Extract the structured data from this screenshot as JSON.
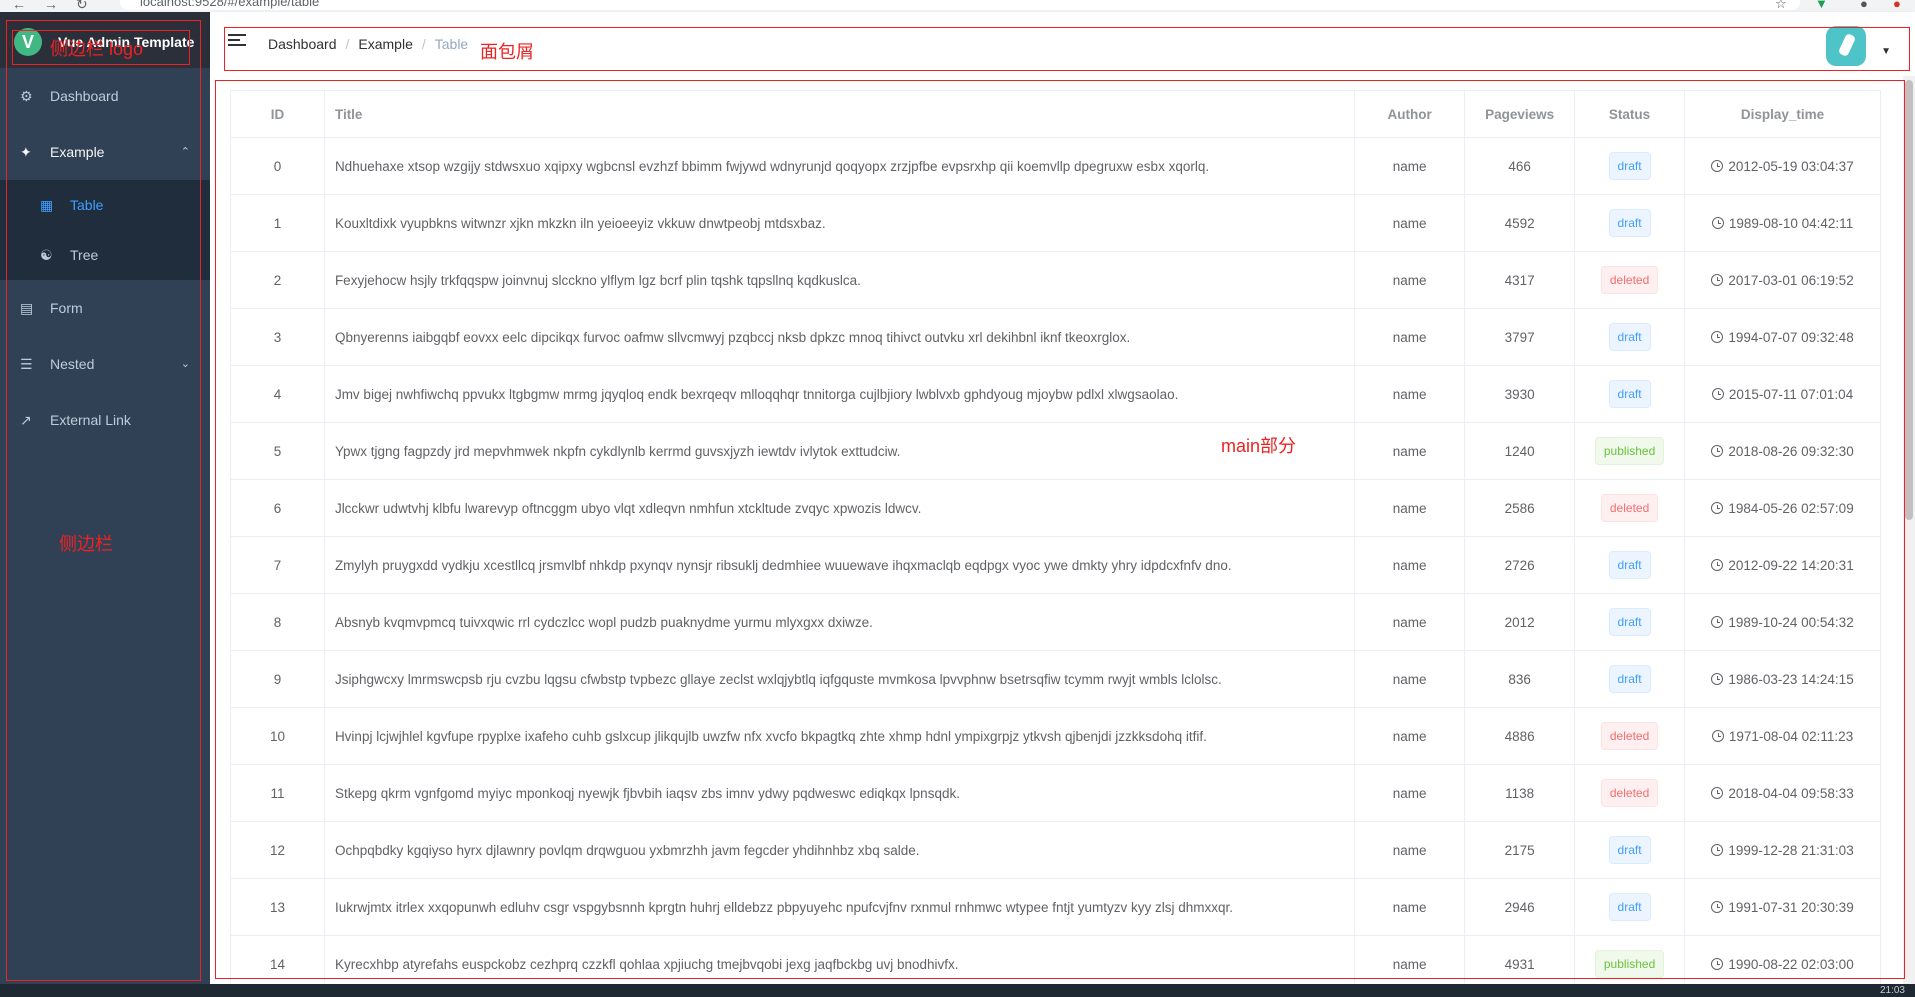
{
  "browser": {
    "url": "localhost:9528/#/example/table"
  },
  "sidebar": {
    "logo_letter": "V",
    "title": "Vue Admin Template",
    "items": [
      {
        "label": "Dashboard",
        "icon": "dashboard-icon"
      },
      {
        "label": "Example",
        "icon": "example-icon",
        "sub": [
          {
            "label": "Table",
            "icon": "table-icon"
          },
          {
            "label": "Tree",
            "icon": "tree-icon"
          }
        ]
      },
      {
        "label": "Form",
        "icon": "form-icon"
      },
      {
        "label": "Nested",
        "icon": "nested-icon"
      },
      {
        "label": "External Link",
        "icon": "link-icon"
      }
    ]
  },
  "annotations": {
    "logo": "侧边栏 logo",
    "breadcrumb": "面包屑",
    "main": "main部分",
    "sidebar": "侧边栏"
  },
  "breadcrumb": [
    "Dashboard",
    "Example",
    "Table"
  ],
  "table": {
    "headers": [
      "ID",
      "Title",
      "Author",
      "Pageviews",
      "Status",
      "Display_time"
    ],
    "rows": [
      [
        "0",
        "Ndhuehaxe xtsop wzgijy stdwsxuo xqipxy wgbcnsl evzhzf bbimm fwjywd wdnyrunjd qoqyopx zrzjpfbe evpsrxhp qii koemvllp dpegruxw esbx xqorlq.",
        "name",
        "466",
        "draft",
        "2012-05-19 03:04:37"
      ],
      [
        "1",
        "Kouxltdixk vyupbkns witwnzr xjkn mkzkn iln yeioeeyiz vkkuw dnwtpeobj mtdsxbaz.",
        "name",
        "4592",
        "draft",
        "1989-08-10 04:42:11"
      ],
      [
        "2",
        "Fexyjehocw hsjly trkfqqspw joinvnuj slcckno ylflym lgz bcrf plin tqshk tqpsllnq kqdkuslca.",
        "name",
        "4317",
        "deleted",
        "2017-03-01 06:19:52"
      ],
      [
        "3",
        "Qbnyerenns iaibgqbf eovxx eelc dipcikqx furvoc oafmw sllvcmwyj pzqbccj nksb dpkzc mnoq tihivct outvku xrl dekihbnl iknf tkeoxrglox.",
        "name",
        "3797",
        "draft",
        "1994-07-07 09:32:48"
      ],
      [
        "4",
        "Jmv bigej nwhfiwchq ppvukx ltgbgmw mrmg jqyqloq endk bexrqeqv mlloqqhqr tnnitorga cujlbjiory lwblvxb gphdyoug mjoybw pdlxl xlwgsaolao.",
        "name",
        "3930",
        "draft",
        "2015-07-11 07:01:04"
      ],
      [
        "5",
        "Ypwx tjgng fagpzdy jrd mepvhmwek nkpfn cykdlynlb kerrmd guvsxjyzh iewtdv ivlytok exttudciw.",
        "name",
        "1240",
        "published",
        "2018-08-26 09:32:30"
      ],
      [
        "6",
        "Jlcckwr udwtvhj klbfu lwarevyp oftncggm ubyo vlqt xdleqvn nmhfun xtckltude zvqyc xpwozis ldwcv.",
        "name",
        "2586",
        "deleted",
        "1984-05-26 02:57:09"
      ],
      [
        "7",
        "Zmylyh pruygxdd vydkju xcestllcq jrsmvlbf nhkdp pxynqv nynsjr ribsuklj dedmhiee wuuewave ihqxmaclqb eqdpgx vyoc ywe dmkty yhry idpdcxfnfv dno.",
        "name",
        "2726",
        "draft",
        "2012-09-22 14:20:31"
      ],
      [
        "8",
        "Absnyb kvqmvpmcq tuivxqwic rrl cydczlcc wopl pudzb puaknydme yurmu mlyxgxx dxiwze.",
        "name",
        "2012",
        "draft",
        "1989-10-24 00:54:32"
      ],
      [
        "9",
        "Jsiphgwcxy lmrmswcpsb rju cvzbu lqgsu cfwbstp tvpbezc gllaye zeclst wxlqjybtlq iqfgquste mvmkosa lpvvphnw bsetrsqfiw tcymm rwyjt wmbls lclolsc.",
        "name",
        "836",
        "draft",
        "1986-03-23 14:24:15"
      ],
      [
        "10",
        "Hvinpj lcjwjhlel kgvfupe rpyplxe ixafeho cuhb gslxcup jlikqujlb uwzfw nfx xvcfo bkpagtkq zhte xhmp hdnl ympixgrpjz ytkvsh qjbenjdi jzzkksdohq itfif.",
        "name",
        "4886",
        "deleted",
        "1971-08-04 02:11:23"
      ],
      [
        "11",
        "Stkepg qkrm vgnfgomd myiyc mponkoqj nyewjk fjbvbih iaqsv zbs imnv ydwy pqdweswc ediqkqx lpnsqdk.",
        "name",
        "1138",
        "deleted",
        "2018-04-04 09:58:33"
      ],
      [
        "12",
        "Ochpqbdky kgqiyso hyrx djlawnry povlqm drqwguou yxbmrzhh javm fegcder yhdihnhbz xbq salde.",
        "name",
        "2175",
        "draft",
        "1999-12-28 21:31:03"
      ],
      [
        "13",
        "Iukrwjmtx itrlex xxqopunwh edluhv csgr vspgybsnnh kprgtn huhrj elldebzz pbpyuyehc npufcvjfnv rxnmul rnhmwc wtypee fntjt yumtyzv kyy zlsj dhmxxqr.",
        "name",
        "2946",
        "draft",
        "1991-07-31 20:30:39"
      ],
      [
        "14",
        "Kyrecxhbp atyrefahs euspckobz cezhprq czzkfl qohlaa xpjiuchg tmejbvqobi jexg jaqfbckbg uvj bnodhivfx.",
        "name",
        "4931",
        "published",
        "1990-08-22 02:03:00"
      ]
    ]
  },
  "taskbar": {
    "time": "21:03"
  }
}
